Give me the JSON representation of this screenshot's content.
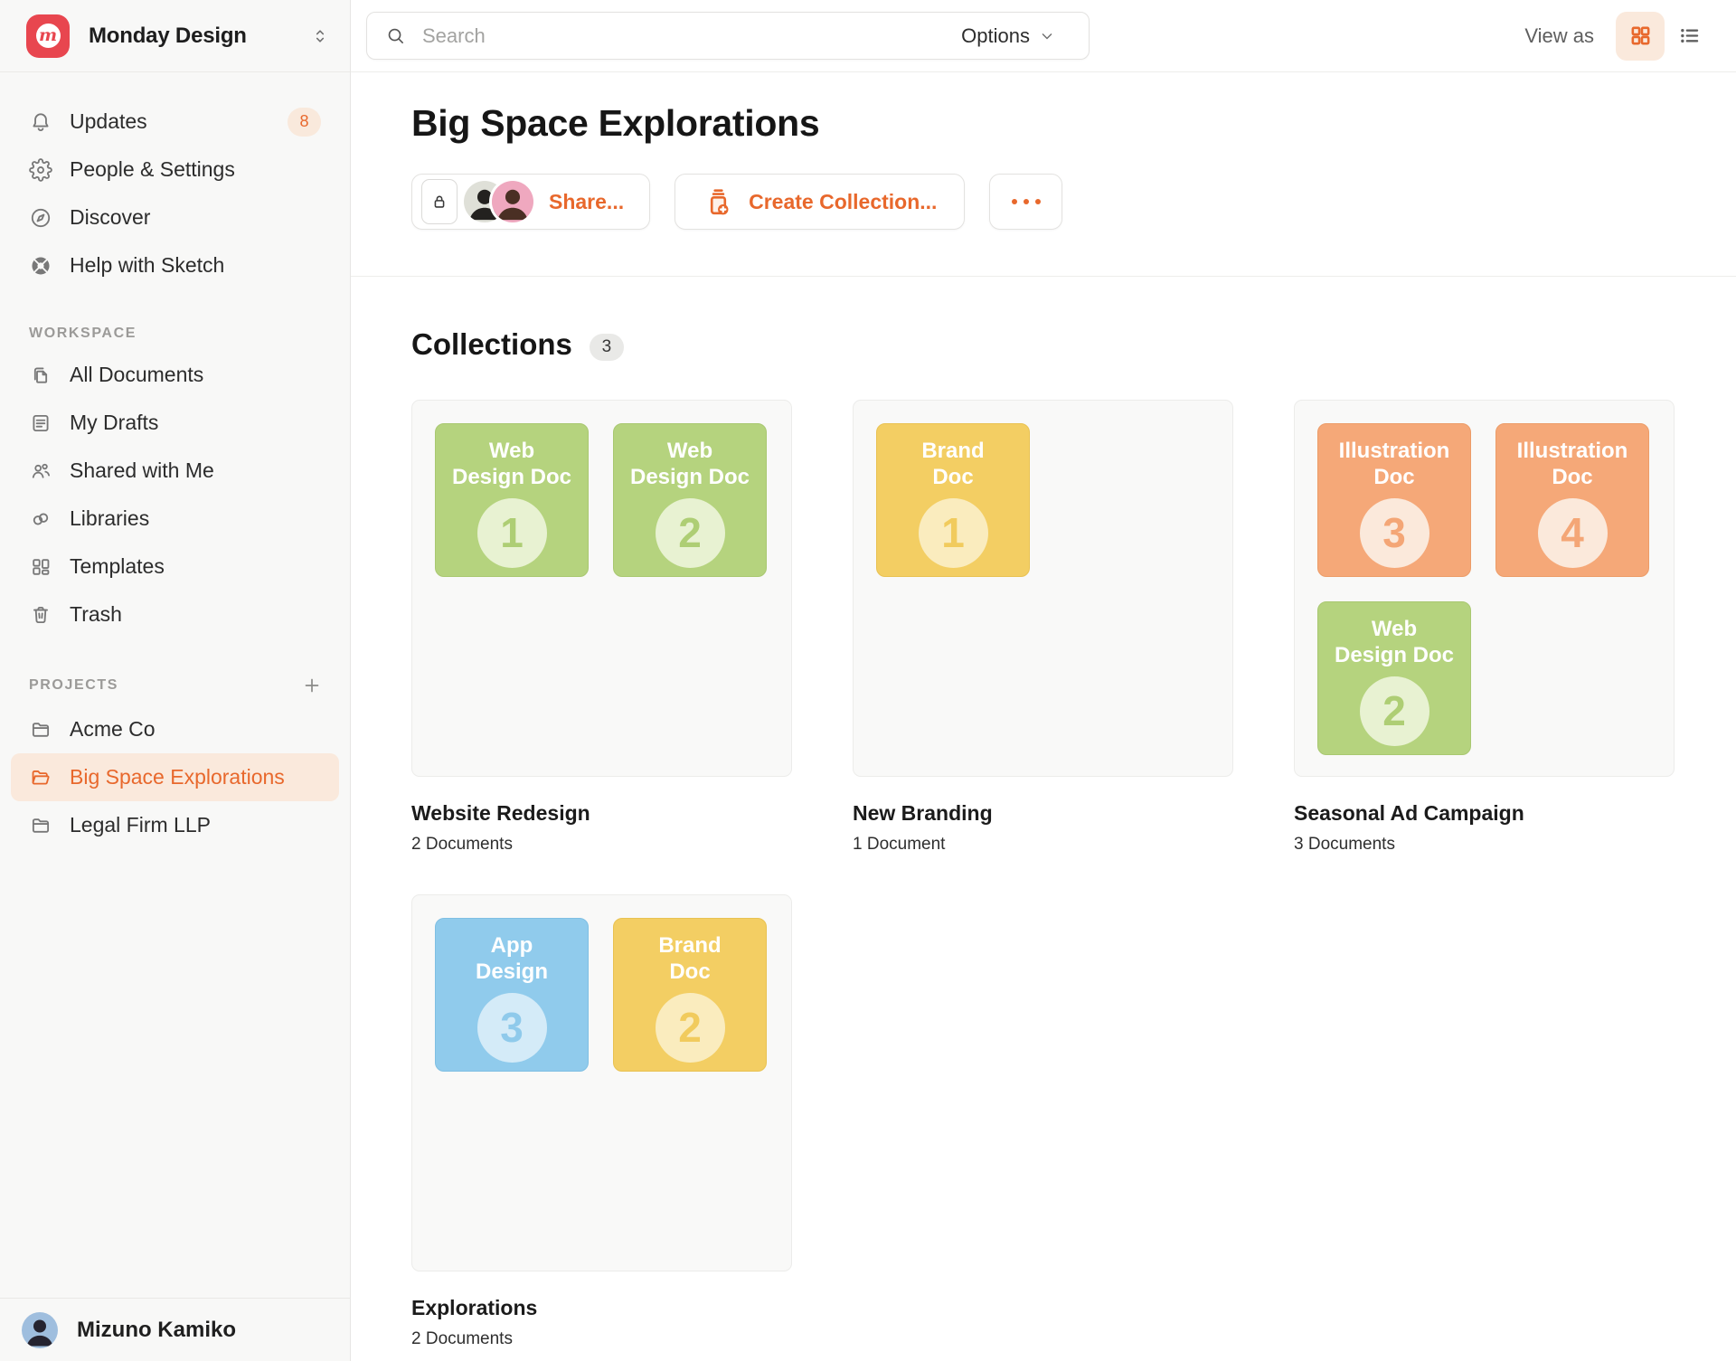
{
  "app": {
    "workspace_name": "Monday Design"
  },
  "topbar": {
    "search_placeholder": "Search",
    "options_label": "Options",
    "view_as_label": "View as"
  },
  "sidebar": {
    "main_items": [
      {
        "id": "updates",
        "icon": "bell",
        "label": "Updates",
        "badge": "8"
      },
      {
        "id": "people-settings",
        "icon": "gear",
        "label": "People & Settings"
      },
      {
        "id": "discover",
        "icon": "compass",
        "label": "Discover"
      },
      {
        "id": "help-with-sketch",
        "icon": "life-ring",
        "label": "Help with Sketch"
      }
    ],
    "sections": [
      {
        "id": "workspace",
        "title": "WORKSPACE",
        "items": [
          {
            "id": "all-documents",
            "icon": "documents",
            "label": "All Documents"
          },
          {
            "id": "my-drafts",
            "icon": "draft",
            "label": "My Drafts"
          },
          {
            "id": "shared-with-me",
            "icon": "people",
            "label": "Shared with Me"
          },
          {
            "id": "libraries",
            "icon": "rings",
            "label": "Libraries"
          },
          {
            "id": "templates",
            "icon": "grid-small",
            "label": "Templates"
          },
          {
            "id": "trash",
            "icon": "trash",
            "label": "Trash"
          }
        ]
      },
      {
        "id": "projects",
        "title": "PROJECTS",
        "has_add_button": true,
        "items": [
          {
            "id": "acme-co",
            "icon": "folder",
            "label": "Acme Co"
          },
          {
            "id": "big-space-explorations",
            "icon": "folder-open",
            "label": "Big Space Explorations",
            "active": true
          },
          {
            "id": "legal-firm-llp",
            "icon": "folder",
            "label": "Legal Firm LLP"
          }
        ]
      }
    ],
    "user": {
      "name": "Mizuno Kamiko"
    }
  },
  "page": {
    "title": "Big Space Explorations",
    "actions": {
      "share_label": "Share...",
      "create_collection_label": "Create Collection...",
      "more_label": "..."
    }
  },
  "collections": {
    "heading": "Collections",
    "count": "3",
    "cards": [
      {
        "title": "Website Redesign",
        "subtitle": "2 Documents",
        "tiles": [
          {
            "lines": [
              "Web",
              "Design Doc"
            ],
            "number": "1",
            "palette": "green"
          },
          {
            "lines": [
              "Web",
              "Design Doc"
            ],
            "number": "2",
            "palette": "green"
          }
        ]
      },
      {
        "title": "New Branding",
        "subtitle": "1 Document",
        "tiles": [
          {
            "lines": [
              "Brand",
              "Doc"
            ],
            "number": "1",
            "palette": "yellow"
          }
        ]
      },
      {
        "title": "Seasonal Ad Campaign",
        "subtitle": "3 Documents",
        "tiles": [
          {
            "lines": [
              "Illustration",
              "Doc"
            ],
            "number": "3",
            "palette": "orange"
          },
          {
            "lines": [
              "Illustration",
              "Doc"
            ],
            "number": "4",
            "palette": "orange"
          },
          {
            "lines": [
              "Web",
              "Design Doc"
            ],
            "number": "2",
            "palette": "green"
          }
        ]
      },
      {
        "title": "Explorations",
        "subtitle": "2 Documents",
        "tiles": [
          {
            "lines": [
              "App",
              "Design"
            ],
            "number": "3",
            "palette": "blue"
          },
          {
            "lines": [
              "Brand",
              "Doc"
            ],
            "number": "2",
            "palette": "yellow"
          }
        ]
      }
    ]
  },
  "colors": {
    "accent": "#E8682C",
    "accent_soft": "#FAE9DC",
    "logo_red": "#E8464F",
    "sidebar_bg": "#F8F8F7",
    "palettes": {
      "green": {
        "bg": "#B5D37E",
        "border": "#A9C871",
        "circle": "#E8F2D2",
        "number": "#AECE74"
      },
      "orange": {
        "bg": "#F5A878",
        "border": "#EC9C68",
        "circle": "#FBE9DB",
        "number": "#F4A676"
      },
      "yellow": {
        "bg": "#F3CE63",
        "border": "#E9C252",
        "circle": "#FAECBE",
        "number": "#F1CB5D"
      },
      "blue": {
        "bg": "#90CBEC",
        "border": "#7FBFE3",
        "circle": "#D4EBF8",
        "number": "#8FCAEB"
      }
    },
    "share_avatars": [
      {
        "bg": "#DFE0D8",
        "tone": "#23211F"
      },
      {
        "bg": "#EFA8BF",
        "tone": "#4A2F24"
      }
    ],
    "user_avatar": {
      "bg": "#9FBEDE",
      "tone": "#262430"
    }
  }
}
